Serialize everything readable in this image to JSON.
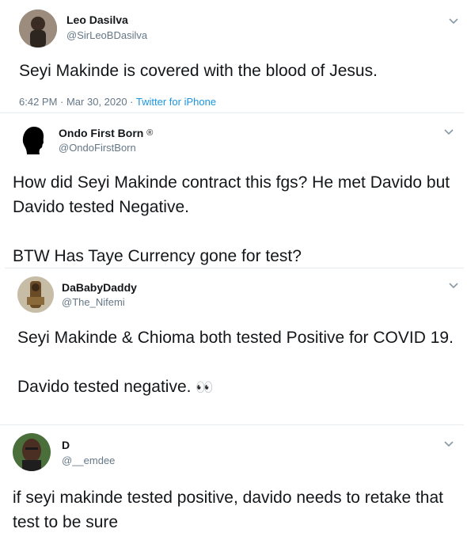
{
  "tweets": [
    {
      "name": "Leo Dasilva",
      "handle": "@SirLeoBDasilva",
      "text": "Seyi Makinde is covered with the blood of Jesus.",
      "time": "6:42 PM · Mar 30, 2020 · ",
      "source": "Twitter for iPhone"
    },
    {
      "name": "Ondo First Born",
      "badge": "®",
      "handle": "@OndoFirstBorn",
      "text": "How did Seyi Makinde contract this fgs? He met Davido but Davido tested Negative.\n\nBTW Has Taye Currency gone for test?"
    },
    {
      "name": "DaBabyDaddy",
      "handle": "@The_Nifemi",
      "text": "Seyi Makinde & Chioma both tested Positive for COVID 19.\n\nDavido tested negative. ",
      "emoji": "👀"
    },
    {
      "name": "D",
      "handle": "@__emdee",
      "text": "if seyi makinde tested positive, davido needs to retake that test to be sure"
    }
  ]
}
